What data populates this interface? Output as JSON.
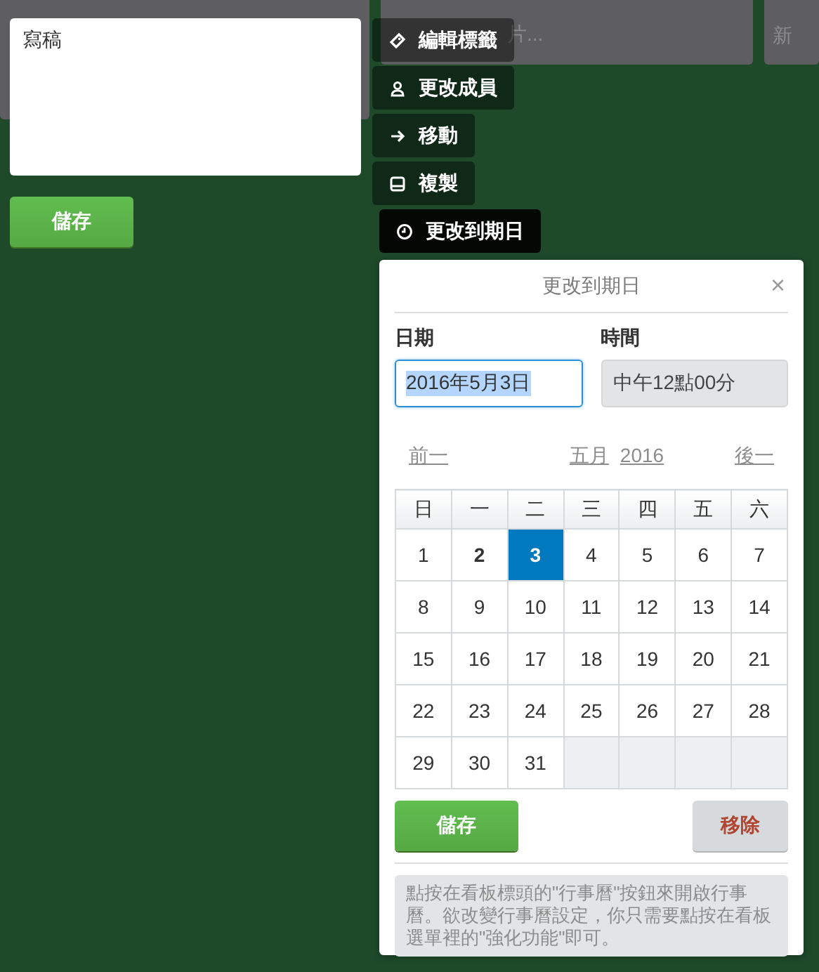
{
  "lists": [
    {
      "composer_text": "片..."
    },
    {
      "composer_text": "新"
    }
  ],
  "card_editor": {
    "value": "寫稿",
    "save_button": "儲存"
  },
  "quick_menu": [
    {
      "label": "編輯標籤",
      "selected": false
    },
    {
      "label": "更改成員",
      "selected": false
    },
    {
      "label": "移動",
      "selected": false
    },
    {
      "label": "複製",
      "selected": false
    },
    {
      "label": "更改到期日",
      "selected": true
    }
  ],
  "popup": {
    "title": "更改到期日",
    "close": "×",
    "date_label": "日期",
    "date_value": "2016年5月3日",
    "time_label": "時間",
    "time_value": "中午12點00分",
    "prev": "前一",
    "month": "五月",
    "year": "2016",
    "next": "後一",
    "weekdays": [
      "日",
      "一",
      "二",
      "三",
      "四",
      "五",
      "六"
    ],
    "weeks": [
      [
        {
          "day": "1",
          "today": false,
          "selected": false
        },
        {
          "day": "2",
          "today": true,
          "selected": false
        },
        {
          "day": "3",
          "today": false,
          "selected": true
        },
        {
          "day": "4",
          "today": false,
          "selected": false
        },
        {
          "day": "5",
          "today": false,
          "selected": false
        },
        {
          "day": "6",
          "today": false,
          "selected": false
        },
        {
          "day": "7",
          "today": false,
          "selected": false
        }
      ],
      [
        {
          "day": "8",
          "today": false,
          "selected": false
        },
        {
          "day": "9",
          "today": false,
          "selected": false
        },
        {
          "day": "10",
          "today": false,
          "selected": false
        },
        {
          "day": "11",
          "today": false,
          "selected": false
        },
        {
          "day": "12",
          "today": false,
          "selected": false
        },
        {
          "day": "13",
          "today": false,
          "selected": false
        },
        {
          "day": "14",
          "today": false,
          "selected": false
        }
      ],
      [
        {
          "day": "15",
          "today": false,
          "selected": false
        },
        {
          "day": "16",
          "today": false,
          "selected": false
        },
        {
          "day": "17",
          "today": false,
          "selected": false
        },
        {
          "day": "18",
          "today": false,
          "selected": false
        },
        {
          "day": "19",
          "today": false,
          "selected": false
        },
        {
          "day": "20",
          "today": false,
          "selected": false
        },
        {
          "day": "21",
          "today": false,
          "selected": false
        }
      ],
      [
        {
          "day": "22",
          "today": false,
          "selected": false
        },
        {
          "day": "23",
          "today": false,
          "selected": false
        },
        {
          "day": "24",
          "today": false,
          "selected": false
        },
        {
          "day": "25",
          "today": false,
          "selected": false
        },
        {
          "day": "26",
          "today": false,
          "selected": false
        },
        {
          "day": "27",
          "today": false,
          "selected": false
        },
        {
          "day": "28",
          "today": false,
          "selected": false
        }
      ],
      [
        {
          "day": "29",
          "today": false,
          "selected": false
        },
        {
          "day": "30",
          "today": false,
          "selected": false
        },
        {
          "day": "31",
          "today": false,
          "selected": false
        }
      ]
    ],
    "save_button": "儲存",
    "remove_button": "移除",
    "note": "點按在看板標頭的\"行事曆\"按鈕來開啟行事曆。欲改變行事曆設定，你只需要點按在看板選單裡的\"強化功能\"即可。"
  }
}
